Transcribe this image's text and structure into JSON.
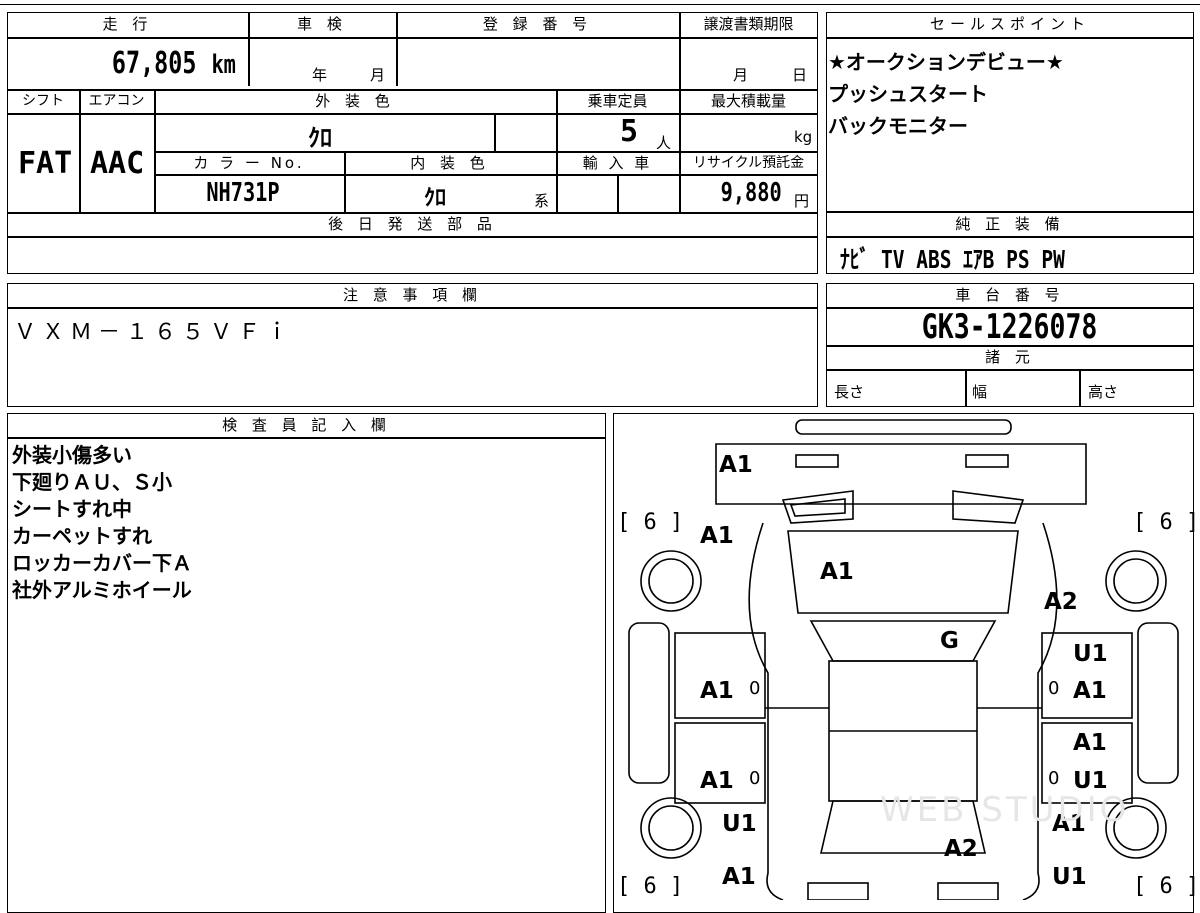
{
  "top_left": {
    "headers": {
      "mileage": "走 行",
      "inspection": "車 検",
      "registration": "登 録 番 号",
      "deadline": "譲渡書類期限"
    },
    "mileage_value": "67,805",
    "mileage_unit": "km",
    "inspection_year": "年",
    "inspection_month": "月",
    "deadline_month": "月",
    "deadline_day": "日",
    "headers2": {
      "shift": "シフト",
      "aircon": "エアコン",
      "exterior": "外 装 色",
      "capacity": "乗車定員",
      "maxload": "最大積載量"
    },
    "shift": "FAT",
    "aircon": "AAC",
    "exterior_color": "ｸﾛ",
    "capacity": "5",
    "capacity_unit": "人",
    "maxload_unit": "kg",
    "headers3": {
      "color_no": "カ ラ ー No.",
      "interior": "内 装 色",
      "import": "輸 入 車",
      "recycle": "リサイクル預託金"
    },
    "color_no": "NH731P",
    "interior_color": "ｸﾛ",
    "interior_suffix": "系",
    "recycle_fee": "9,880",
    "recycle_unit": "円",
    "later_parts_header": "後 日 発 送 部 品"
  },
  "sales_points": {
    "header": "セールスポイント",
    "lines": [
      "★オークションデビュー★",
      "プッシュスタート",
      "バックモニター"
    ]
  },
  "equipment": {
    "header": "純 正 装 備",
    "value": "ﾅﾋﾞ TV ABS ｴｱB PS PW"
  },
  "notes": {
    "header": "注 意 事 項 欄",
    "value": "ＶＸＭ－１６５ＶＦｉ"
  },
  "chassis": {
    "header": "車 台 番 号",
    "value": "GK3-1226078",
    "spec_header": "諸 元",
    "length": "長さ",
    "width": "幅",
    "height": "高さ"
  },
  "inspector": {
    "header": "検 査 員 記 入 欄",
    "lines": [
      "外装小傷多い",
      "下廻りＡＵ、Ｓ小",
      "シートすれ中",
      "カーペットすれ",
      "ロッカーカバー下Ａ",
      "社外アルミホイール"
    ]
  },
  "diagram": {
    "bracket": "[ 6 ]",
    "labels": {
      "front_bumper": "A1",
      "front_left_fender": "A1",
      "hood": "A1",
      "front_right_fender": "A2",
      "windshield": "G",
      "right_front_door_1": "U1",
      "left_front_door": "A1",
      "right_front_door_2": "A1",
      "right_rear_door_1": "A1",
      "left_rear_door": "A1",
      "right_rear_door_2": "U1",
      "left_rear_quarter": "U1",
      "right_rear_quarter": "A1",
      "roof_rear": "A2",
      "left_rear_bumper": "A1",
      "right_rear_bumper": "U1"
    },
    "zero": "0"
  },
  "watermark": "WEB STUDIO"
}
